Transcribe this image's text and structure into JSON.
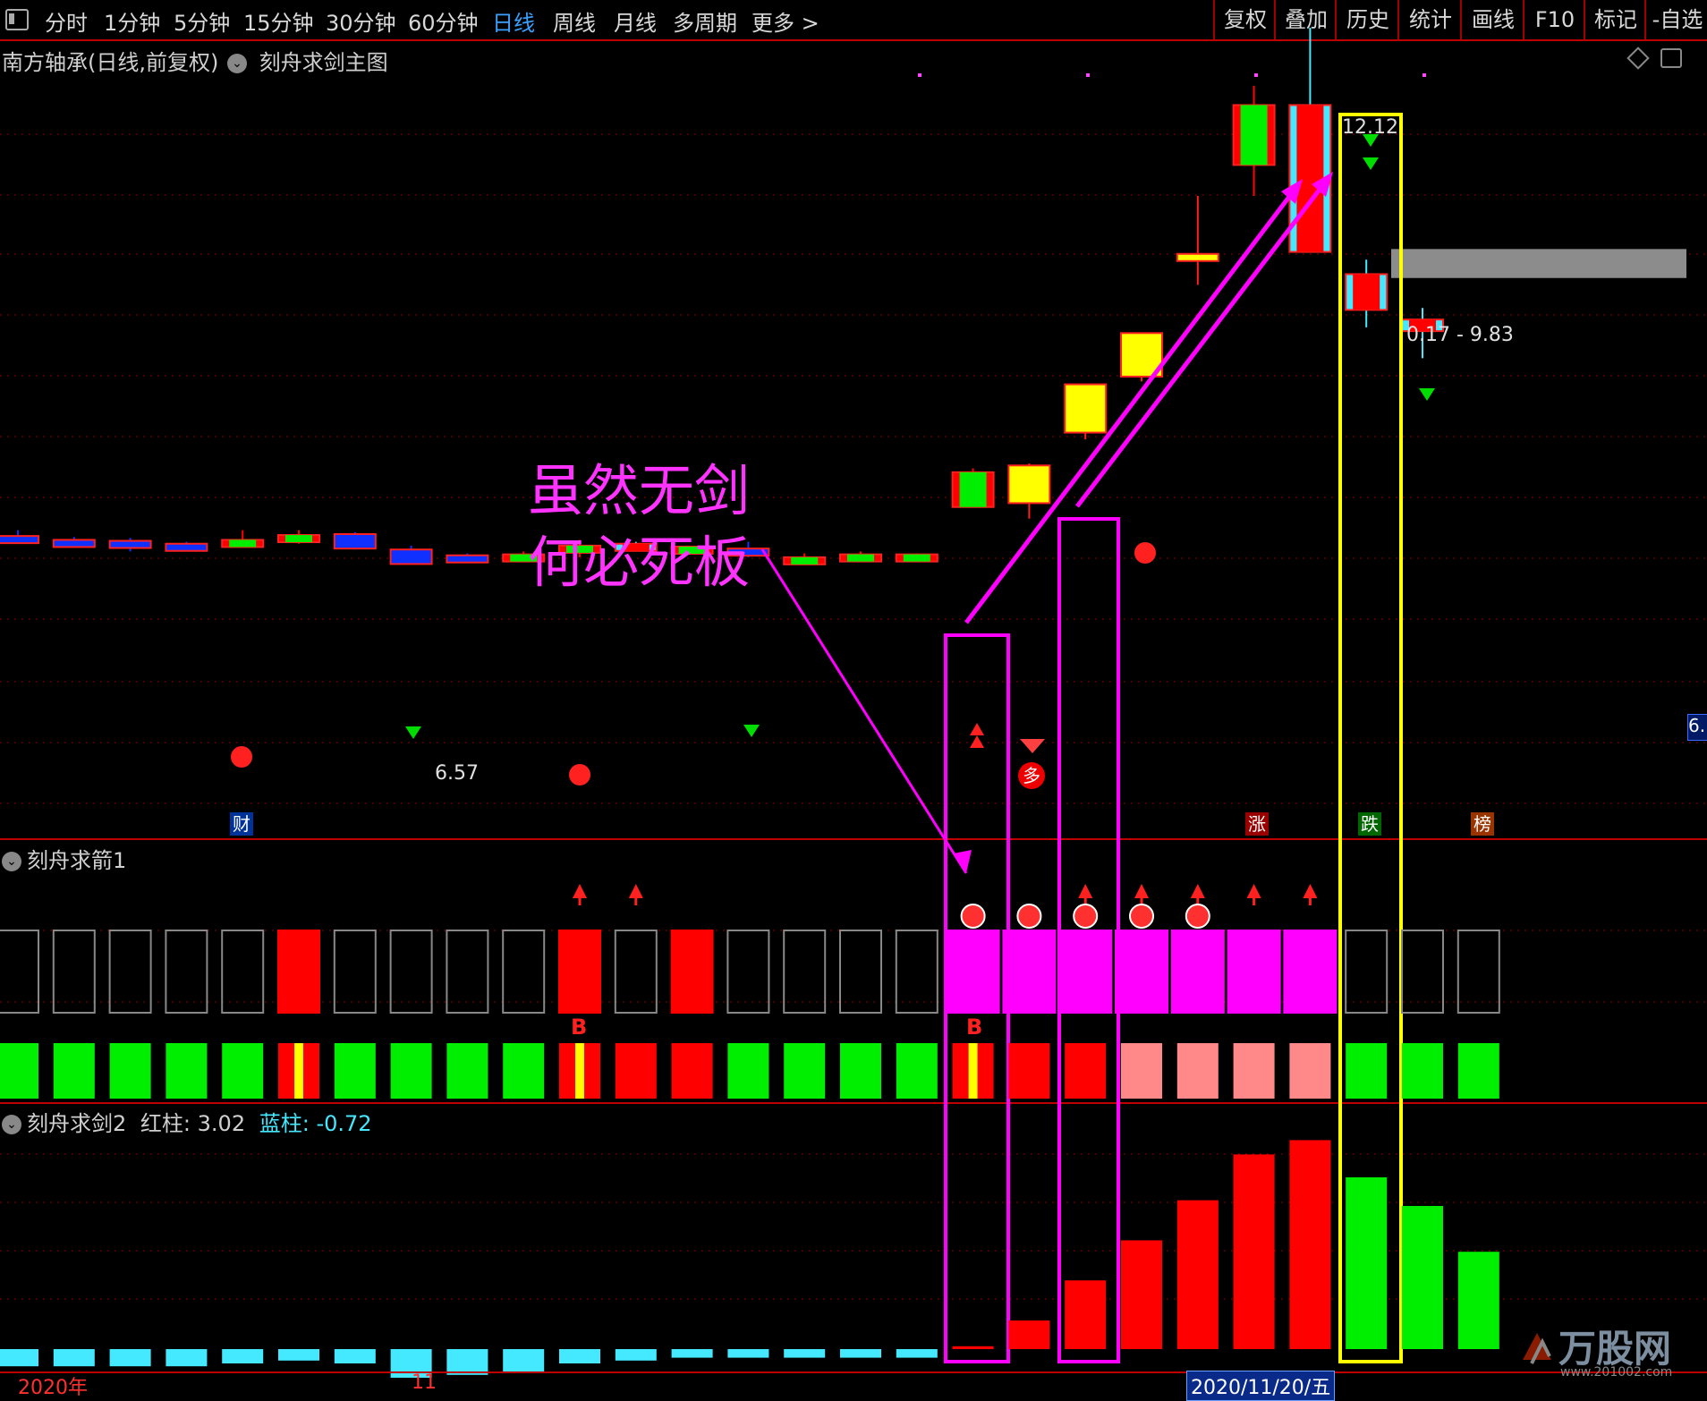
{
  "toolbar": {
    "tabs": [
      "分时",
      "1分钟",
      "5分钟",
      "15分钟",
      "30分钟",
      "60分钟",
      "日线",
      "周线",
      "月线",
      "多周期",
      "更多 >"
    ],
    "active": "日线",
    "right_buttons": [
      "复权",
      "叠加",
      "历史",
      "统计",
      "画线",
      "F10",
      "标记",
      "-自选"
    ]
  },
  "main_panel": {
    "title": "南方轴承(日线,前复权)",
    "indicator": "刻舟求剑主图",
    "price_high_label": "12.12",
    "price_low_label": "6.57",
    "range_label": "0.17 - 9.83",
    "right_edge_label": "6.",
    "event_tags": {
      "cai": "财",
      "zhang": "涨",
      "die": "跌",
      "bang": "榜"
    },
    "duo_label": "多"
  },
  "annotation": {
    "line1": "虽然无剑",
    "line2": "何必死板"
  },
  "panel2": {
    "title": "刻舟求箭1",
    "b_label": "B"
  },
  "panel3": {
    "title": "刻舟求剑2",
    "red_label": "红柱:",
    "red_value": "3.02",
    "blue_label": "蓝柱:",
    "blue_value": "-0.72"
  },
  "date_axis": {
    "year": "2020年",
    "month": "11",
    "cursor_date": "2020/11/20/五"
  },
  "watermark": {
    "brand": "万股网",
    "url": "www.201002.com"
  },
  "colors": {
    "up": "#ff0000",
    "cyan": "#44e8ff",
    "blue": "#1030ff",
    "yellow": "#ffff00",
    "magenta": "#ff00ff",
    "green": "#00ee00",
    "pink": "#ff8888",
    "gray_zone": "#8c8c8c",
    "grid": "#8a0000"
  },
  "chart_data": {
    "type": "candlestick",
    "candles": [
      {
        "open": 6.85,
        "close": 6.86,
        "high": 6.92,
        "low": 6.8,
        "color": "blue"
      },
      {
        "open": 6.82,
        "close": 6.77,
        "high": 6.85,
        "low": 6.74,
        "color": "blue"
      },
      {
        "open": 6.8,
        "close": 6.81,
        "high": 6.84,
        "low": 6.7,
        "color": "blue"
      },
      {
        "open": 6.76,
        "close": 6.78,
        "high": 6.8,
        "low": 6.74,
        "color": "blue"
      },
      {
        "open": 6.78,
        "close": 6.82,
        "high": 6.92,
        "low": 6.76,
        "color": "red"
      },
      {
        "open": 6.8,
        "close": 6.87,
        "high": 6.92,
        "low": 6.78,
        "color": "red"
      },
      {
        "open": 6.88,
        "close": 6.73,
        "high": 6.9,
        "low": 6.72,
        "color": "blue"
      },
      {
        "open": 6.72,
        "close": 6.57,
        "high": 6.76,
        "low": 6.57,
        "color": "blue"
      },
      {
        "open": 6.62,
        "close": 6.66,
        "high": 6.68,
        "low": 6.58,
        "color": "blue"
      },
      {
        "open": 6.64,
        "close": 6.67,
        "high": 6.7,
        "low": 6.62,
        "color": "red"
      },
      {
        "open": 6.7,
        "close": 6.76,
        "high": 6.82,
        "low": 6.64,
        "color": "red"
      },
      {
        "open": 6.73,
        "close": 6.78,
        "high": 6.8,
        "low": 6.72,
        "color": "cyan"
      },
      {
        "open": 6.72,
        "close": 6.75,
        "high": 6.76,
        "low": 6.7,
        "color": "red"
      },
      {
        "open": 6.73,
        "close": 6.68,
        "high": 6.8,
        "low": 6.64,
        "color": "blue"
      },
      {
        "open": 6.62,
        "close": 6.64,
        "high": 6.68,
        "low": 6.6,
        "color": "red"
      },
      {
        "open": 6.66,
        "close": 6.67,
        "high": 6.7,
        "low": 6.64,
        "color": "red"
      },
      {
        "open": 6.66,
        "close": 6.67,
        "high": 6.68,
        "low": 6.64,
        "color": "red"
      },
      {
        "open": 7.16,
        "close": 7.52,
        "high": 7.56,
        "low": 7.16,
        "color": "red"
      },
      {
        "open": 7.2,
        "close": 7.59,
        "high": 7.61,
        "low": 7.04,
        "color": "yellow"
      },
      {
        "open": 7.93,
        "close": 8.43,
        "high": 8.43,
        "low": 7.86,
        "color": "yellow"
      },
      {
        "open": 8.51,
        "close": 8.96,
        "high": 8.96,
        "low": 8.46,
        "color": "yellow"
      },
      {
        "open": 9.71,
        "close": 9.78,
        "high": 10.38,
        "low": 9.46,
        "color": "yellow"
      },
      {
        "open": 10.7,
        "close": 11.32,
        "high": 11.52,
        "low": 10.38,
        "color": "red"
      },
      {
        "open": 11.32,
        "close": 9.8,
        "high": 12.12,
        "low": 9.8,
        "color": "cyan"
      },
      {
        "open": 9.2,
        "close": 9.57,
        "high": 9.72,
        "low": 9.02,
        "color": "cyan"
      },
      {
        "open": 8.98,
        "close": 9.1,
        "high": 9.22,
        "low": 8.7,
        "color": "cyan"
      }
    ],
    "range_zone": [
      9.53,
      9.83
    ],
    "panel2_top": [
      "empty",
      "empty",
      "empty",
      "empty",
      "empty",
      "red",
      "empty",
      "empty",
      "empty",
      "empty",
      "red",
      "empty",
      "red",
      "empty",
      "empty",
      "empty",
      "empty",
      "magenta",
      "magenta",
      "magenta",
      "magenta",
      "magenta",
      "magenta",
      "magenta",
      "empty",
      "empty",
      "empty"
    ],
    "panel2_bottom": [
      "green",
      "green",
      "green",
      "green",
      "green",
      "fire",
      "green",
      "green",
      "green",
      "green",
      "fire",
      "red",
      "red",
      "green",
      "green",
      "green",
      "green",
      "fire",
      "red",
      "red",
      "pink",
      "pink",
      "pink",
      "pink",
      "green",
      "green",
      "green"
    ],
    "panel3_bars": [
      {
        "value": -0.3,
        "color": "cyan"
      },
      {
        "value": -0.3,
        "color": "cyan"
      },
      {
        "value": -0.3,
        "color": "cyan"
      },
      {
        "value": -0.3,
        "color": "cyan"
      },
      {
        "value": -0.25,
        "color": "cyan"
      },
      {
        "value": -0.2,
        "color": "cyan"
      },
      {
        "value": -0.25,
        "color": "cyan"
      },
      {
        "value": -0.5,
        "color": "cyan"
      },
      {
        "value": -0.45,
        "color": "cyan"
      },
      {
        "value": -0.4,
        "color": "cyan"
      },
      {
        "value": -0.25,
        "color": "cyan"
      },
      {
        "value": -0.2,
        "color": "cyan"
      },
      {
        "value": -0.15,
        "color": "cyan"
      },
      {
        "value": -0.15,
        "color": "cyan"
      },
      {
        "value": -0.15,
        "color": "cyan"
      },
      {
        "value": -0.15,
        "color": "cyan"
      },
      {
        "value": -0.15,
        "color": "cyan"
      },
      {
        "value": 0.05,
        "color": "red"
      },
      {
        "value": 0.5,
        "color": "red"
      },
      {
        "value": 1.2,
        "color": "red"
      },
      {
        "value": 1.9,
        "color": "red"
      },
      {
        "value": 2.6,
        "color": "red"
      },
      {
        "value": 3.4,
        "color": "red"
      },
      {
        "value": 3.65,
        "color": "red"
      },
      {
        "value": 3.0,
        "color": "green"
      },
      {
        "value": 2.5,
        "color": "green"
      },
      {
        "value": 1.7,
        "color": "green"
      }
    ]
  }
}
